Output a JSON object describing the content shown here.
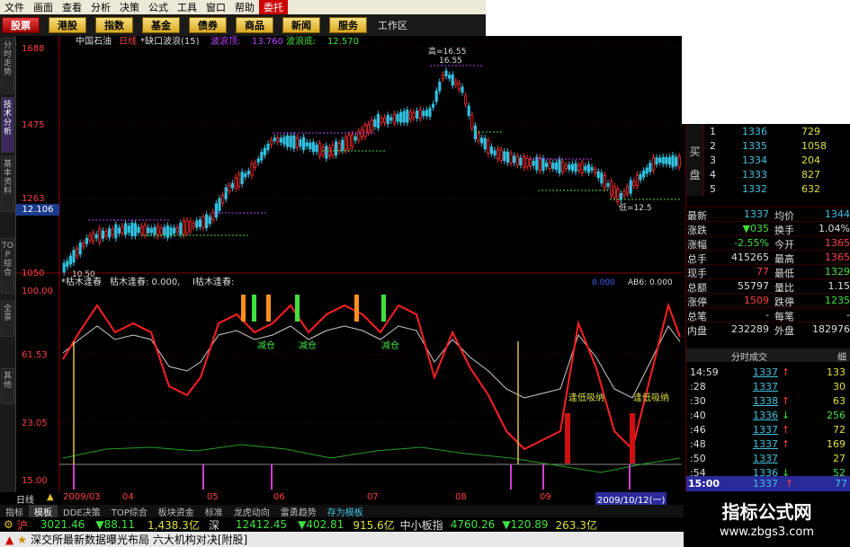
{
  "menu": [
    "文件",
    "画面",
    "查看",
    "分析",
    "决策",
    "公式",
    "工具",
    "窗口",
    "帮助",
    "委托"
  ],
  "toolbar": {
    "buttons": [
      "股票",
      "港股",
      "指数",
      "基金",
      "债券",
      "商品",
      "新闻",
      "服务"
    ],
    "workarea": "工作区"
  },
  "left_tabs": [
    "分时走势",
    "技术分析",
    "基本资料",
    "TOP综合",
    "全景",
    "其他"
  ],
  "chart": {
    "header": {
      "stock": "中国石油",
      "period": "日线",
      "indicator": "*缺口波浪(15)",
      "wave_high_label": "波浪顶:",
      "wave_high": "13.760",
      "wave_low_label": "波浪底:",
      "wave_low": "12.570"
    },
    "price_axis": [
      "1688",
      "1475",
      "1263",
      "1050"
    ],
    "current_price_tag": "12.106",
    "high_label": "高=16.55",
    "high_label2": "16.55",
    "low_label": "低=12.5",
    "bottom_left_label": "10.50",
    "sub_header": {
      "name": "*枯木逢春",
      "value_label": "枯木逢春: 0.000,",
      "value_label2": "I枯木逢春:"
    },
    "sub_right_labels": [
      "0.000",
      "AB6: 0.000"
    ],
    "osc_axis": [
      "100.00",
      "61.53",
      "23.05",
      "15.00"
    ],
    "annotations": [
      "减仓",
      "减仓",
      "减仓",
      "逢低吸纳",
      "逢低吸纳"
    ],
    "dates": [
      "2009/03",
      "04",
      "05",
      "06",
      "07",
      "08",
      "09"
    ],
    "date_current": "2009/10/12(一)",
    "period_label": "日线"
  },
  "orderbook": {
    "side_label": "买盘",
    "rows": [
      {
        "no": "1",
        "price": "1336",
        "vol": "729"
      },
      {
        "no": "2",
        "price": "1335",
        "vol": "1058"
      },
      {
        "no": "3",
        "price": "1334",
        "vol": "204"
      },
      {
        "no": "4",
        "price": "1333",
        "vol": "827"
      },
      {
        "no": "5",
        "price": "1332",
        "vol": "632"
      }
    ]
  },
  "stats": [
    {
      "l": "最新",
      "v": "1337",
      "l2": "均价",
      "v2": "1344"
    },
    {
      "l": "涨跌",
      "v": "▼035",
      "l2": "换手",
      "v2": "1.04%"
    },
    {
      "l": "涨幅",
      "v": "-2.55%",
      "l2": "今开",
      "v2": "1365"
    },
    {
      "l": "总手",
      "v": "415265",
      "l2": "最高",
      "v2": "1365"
    },
    {
      "l": "现手",
      "v": "77",
      "l2": "最低",
      "v2": "1329"
    },
    {
      "l": "总额",
      "v": "55797",
      "l2": "量比",
      "v2": "1.15"
    },
    {
      "l": "涨停",
      "v": "1509",
      "l2": "跌停",
      "v2": "1235"
    },
    {
      "l": "总笔",
      "v": "-",
      "l2": "每笔",
      "v2": "-"
    },
    {
      "l": "内盘",
      "v": "232289",
      "l2": "外盘",
      "v2": "182976"
    }
  ],
  "trades_header": "分时成交",
  "trades_header_right": "细",
  "trades": [
    {
      "t": "14:59",
      "p": "1337",
      "a": "↑",
      "v": "133"
    },
    {
      "t": ":28",
      "p": "1337",
      "a": "",
      "v": "30"
    },
    {
      "t": ":30",
      "p": "1338",
      "a": "↑",
      "v": "63"
    },
    {
      "t": ":40",
      "p": "1336",
      "a": "↓",
      "v": "256"
    },
    {
      "t": ":46",
      "p": "1337",
      "a": "↑",
      "v": "72"
    },
    {
      "t": ":48",
      "p": "1337",
      "a": "↑",
      "v": "169"
    },
    {
      "t": ":50",
      "p": "1337",
      "a": "",
      "v": "27"
    },
    {
      "t": ":54",
      "p": "1336",
      "a": "↓",
      "v": "52"
    }
  ],
  "last_trade": {
    "t": "15:00",
    "p": "1337",
    "a": "↑",
    "v": "77"
  },
  "tabs": [
    "指标",
    "模板",
    "DDE决策",
    "TOP综合",
    "板块资金",
    "标准",
    "龙虎动向",
    "雷勇趋势",
    "存为模板"
  ],
  "status": {
    "sh_label": "沪",
    "sh_index": "3021.46",
    "sh_chg": "▼88.11",
    "sh_amt": "1,438.3亿",
    "sz_label": "深",
    "sz_index": "12412.45",
    "sz_chg": "▼402.81",
    "sz_amt": "915.6亿",
    "zxb_label": "中小板指",
    "zxb_index": "4760.26",
    "zxb_chg": "▼120.89",
    "zxb_amt": "263.3亿"
  },
  "news": "深交所最新数据曝光布局 六大机构对决[附股]",
  "watermark": {
    "title": "指标公式网",
    "url": "www.zbgs3.com"
  }
}
